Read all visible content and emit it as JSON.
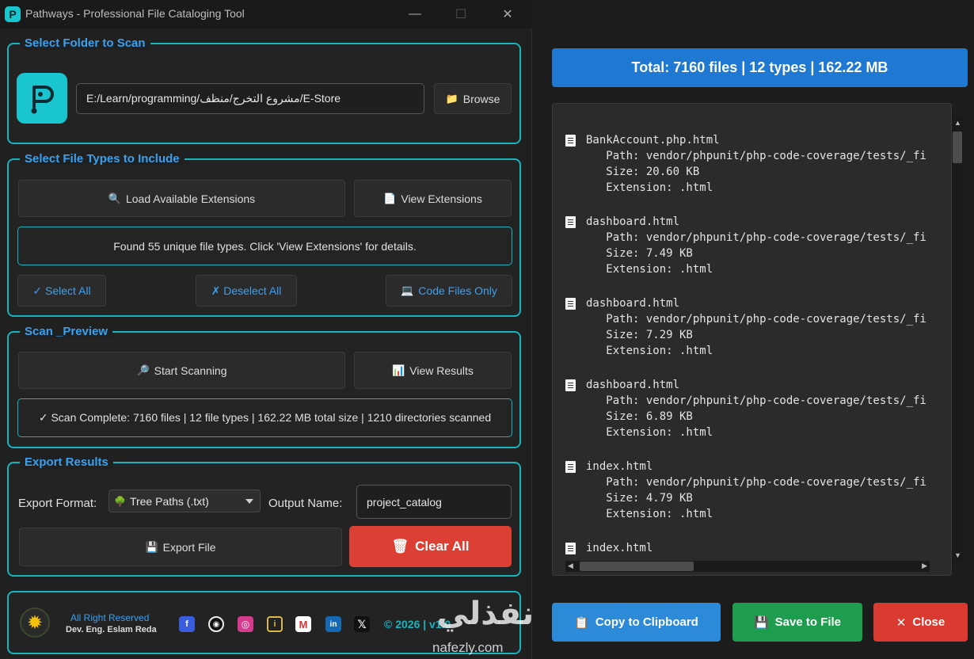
{
  "window": {
    "title": "Pathways - Professional File Cataloging Tool",
    "app_icon_letter": "P",
    "minimize": "—",
    "maximize": "☐",
    "close": "✕"
  },
  "folder": {
    "title": "Select Folder to Scan",
    "path": "E:/Learn/programming/مشروع التخرج/منظف/E-Store",
    "browse_icon": "📁",
    "browse": "Browse"
  },
  "types": {
    "title": "Select File Types to Include",
    "load_icon": "🔍",
    "load": "Load Available Extensions",
    "view_icon": "📄",
    "view": "View Extensions",
    "found_text": "Found 55 unique file types. Click 'View Extensions' for details.",
    "select_all": "✓ Select All",
    "deselect_all": "✗ Deselect All",
    "code_icon": "💻",
    "code_only": "Code Files Only"
  },
  "scan": {
    "title": "Scan _Preview",
    "start_icon": "🔎",
    "start": "Start Scanning",
    "results_icon": "📊",
    "results": "View Results",
    "status": "✓ Scan Complete: 7160 files | 12 file types | 162.22 MB total size | 1210 directories scanned"
  },
  "export": {
    "title": "Export Results",
    "format_label": "Export Format:",
    "format_icon": "🌳",
    "format_value": "Tree Paths (.txt)",
    "output_label": "Output Name:",
    "output_value": "project_catalog",
    "export_icon": "💾",
    "export": "Export File",
    "clear_icon": "🗑",
    "clear": "Clear All"
  },
  "footer": {
    "rights": "All Right Reserved",
    "author": "Dev. Eng. Eslam Reda",
    "copyright": "© 2026 | v1.0",
    "icons": [
      "facebook-icon",
      "github-icon",
      "instagram-icon",
      "info-icon",
      "gmail-icon",
      "linkedin-icon",
      "x-icon"
    ]
  },
  "summary": {
    "total": "Total: 7160 files | 12 types | 162.22 MB"
  },
  "files": [
    {
      "name": "BankAccount.php.html",
      "path": "   Path: vendor/phpunit/php-code-coverage/tests/_fi",
      "size": "   Size: 20.60 KB",
      "ext": "   Extension: .html"
    },
    {
      "name": "dashboard.html",
      "path": "   Path: vendor/phpunit/php-code-coverage/tests/_fi",
      "size": "   Size: 7.49 KB",
      "ext": "   Extension: .html"
    },
    {
      "name": "dashboard.html",
      "path": "   Path: vendor/phpunit/php-code-coverage/tests/_fi",
      "size": "   Size: 7.29 KB",
      "ext": "   Extension: .html"
    },
    {
      "name": "dashboard.html",
      "path": "   Path: vendor/phpunit/php-code-coverage/tests/_fi",
      "size": "   Size: 6.89 KB",
      "ext": "   Extension: .html"
    },
    {
      "name": "index.html",
      "path": "   Path: vendor/phpunit/php-code-coverage/tests/_fi",
      "size": "   Size: 4.79 KB",
      "ext": "   Extension: .html"
    },
    {
      "name": "index.html",
      "path": "",
      "size": "",
      "ext": ""
    }
  ],
  "actions": {
    "copy_icon": "📋",
    "copy": "Copy to Clipboard",
    "save_icon": "💾",
    "save": "Save to File",
    "close_icon": "✕",
    "close": "Close"
  },
  "watermark": {
    "arabic": "نفذلي",
    "latin": "nafezly.com"
  },
  "colors": {
    "accent": "#16b4bd",
    "title_blue": "#3aa0f0",
    "banner": "#1f78d1",
    "clear_red": "#dc3f33",
    "copy_blue": "#2d8ad8",
    "save_green": "#1f9d4e",
    "close_red": "#d9392f"
  }
}
